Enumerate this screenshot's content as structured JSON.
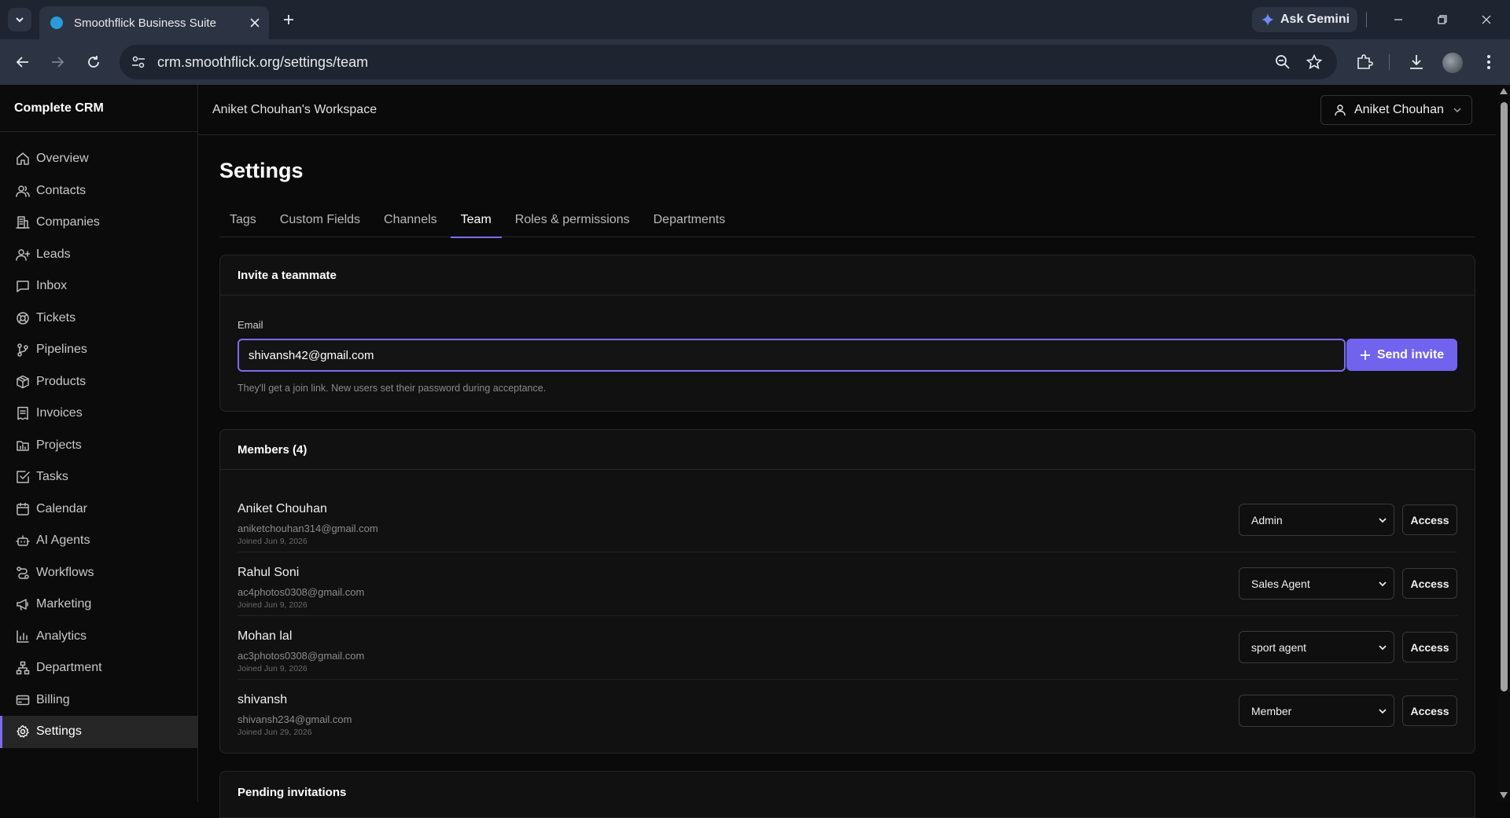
{
  "browser": {
    "tab_title": "Smoothflick Business Suite",
    "gemini_label": "Ask Gemini",
    "url": "crm.smoothflick.org/settings/team"
  },
  "sidebar": {
    "brand": "Complete CRM",
    "items": [
      {
        "label": "Overview",
        "icon": "home-icon"
      },
      {
        "label": "Contacts",
        "icon": "users-icon"
      },
      {
        "label": "Companies",
        "icon": "building-icon"
      },
      {
        "label": "Leads",
        "icon": "user-plus-icon"
      },
      {
        "label": "Inbox",
        "icon": "message-icon"
      },
      {
        "label": "Tickets",
        "icon": "lifebuoy-icon"
      },
      {
        "label": "Pipelines",
        "icon": "git-branch-icon"
      },
      {
        "label": "Products",
        "icon": "package-icon"
      },
      {
        "label": "Invoices",
        "icon": "receipt-icon"
      },
      {
        "label": "Projects",
        "icon": "folder-chart-icon"
      },
      {
        "label": "Tasks",
        "icon": "check-square-icon"
      },
      {
        "label": "Calendar",
        "icon": "calendar-icon"
      },
      {
        "label": "AI Agents",
        "icon": "bot-icon"
      },
      {
        "label": "Workflows",
        "icon": "workflow-icon"
      },
      {
        "label": "Marketing",
        "icon": "megaphone-icon"
      },
      {
        "label": "Analytics",
        "icon": "bar-chart-icon"
      },
      {
        "label": "Department",
        "icon": "network-icon"
      },
      {
        "label": "Billing",
        "icon": "credit-card-icon"
      },
      {
        "label": "Settings",
        "icon": "gear-icon",
        "active": true
      }
    ]
  },
  "topbar": {
    "workspace": "Aniket Chouhan's Workspace",
    "user": "Aniket Chouhan"
  },
  "page": {
    "title": "Settings",
    "tabs": [
      "Tags",
      "Custom Fields",
      "Channels",
      "Team",
      "Roles & permissions",
      "Departments"
    ],
    "active_tab": "Team"
  },
  "invite": {
    "heading": "Invite a teammate",
    "email_label": "Email",
    "email_value": "shivansh42@gmail.com",
    "send_label": "Send invite",
    "hint": "They'll get a join link. New users set their password during acceptance."
  },
  "members": {
    "heading": "Members (4)",
    "access_label": "Access",
    "rows": [
      {
        "name": "Aniket Chouhan",
        "email": "aniketchouhan314@gmail.com",
        "joined": "Joined Jun 9, 2026",
        "role": "Admin"
      },
      {
        "name": "Rahul Soni",
        "email": "ac4photos0308@gmail.com",
        "joined": "Joined Jun 9, 2026",
        "role": "Sales Agent"
      },
      {
        "name": "Mohan lal",
        "email": "ac3photos0308@gmail.com",
        "joined": "Joined Jun 9, 2026",
        "role": "sport agent"
      },
      {
        "name": "shivansh",
        "email": "shivansh234@gmail.com",
        "joined": "Joined Jun 29, 2026",
        "role": "Member"
      }
    ]
  },
  "pending": {
    "heading": "Pending invitations"
  },
  "colors": {
    "accent": "#7c6cf0",
    "button": "#7163ee",
    "background": "#0a0a0a"
  }
}
